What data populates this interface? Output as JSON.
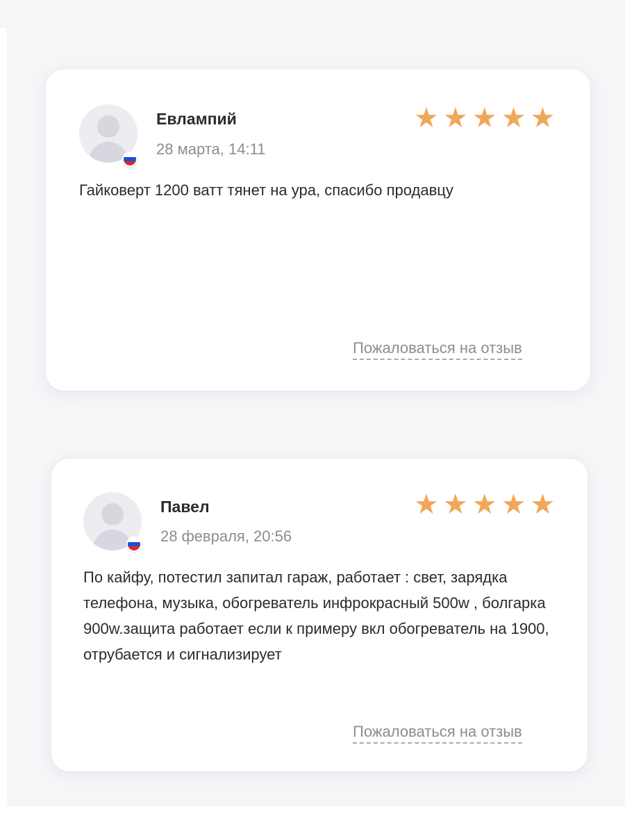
{
  "reviews": [
    {
      "author": "Евлампий",
      "date": "28 марта, 14:11",
      "rating": 5,
      "text": "Гайковерт 1200 ватт тянет на ура, спасибо продавцу",
      "complain_label": "Пожаловаться на отзыв",
      "avatar_icon": "user-placeholder-icon",
      "flag_icon": "russia-flag-icon"
    },
    {
      "author": "Павел",
      "date": "28 февраля, 20:56",
      "rating": 5,
      "text": "По кайфу, потестил запитал гараж, работает : свет, зарядка телефона, музыка, обогреватель инфрокрасный 500w , болгарка 900w.защита работает если к примеру вкл обогреватель на 1900, отрубается и сигнализирует",
      "complain_label": "Пожаловаться на отзыв",
      "avatar_icon": "user-placeholder-icon",
      "flag_icon": "russia-flag-icon"
    }
  ],
  "colors": {
    "star": "#f0a75a",
    "muted_text": "#8c8c93",
    "card_bg": "#ffffff",
    "page_bg": "#f6f6f9"
  }
}
